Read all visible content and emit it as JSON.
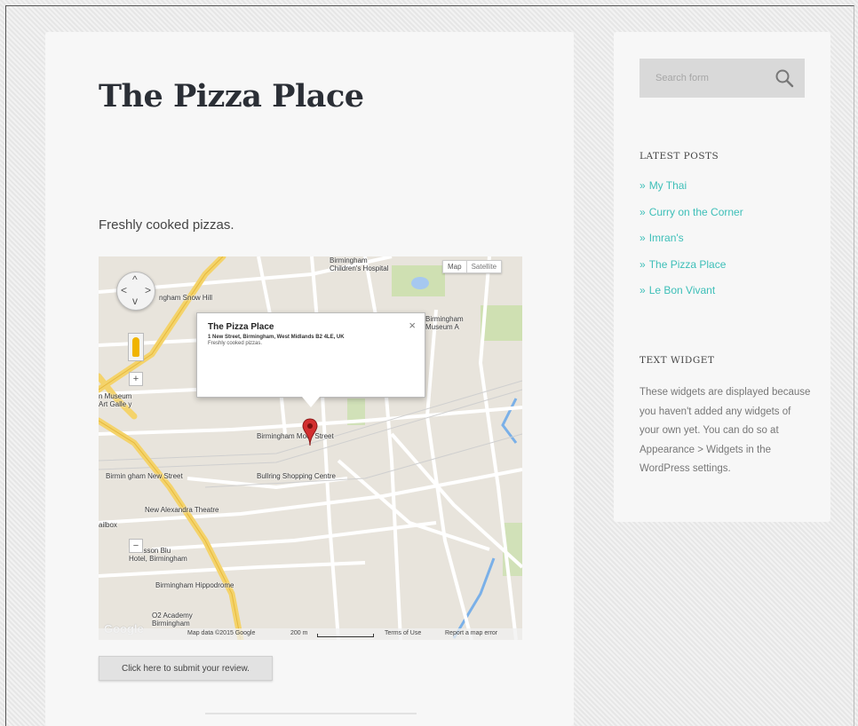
{
  "post": {
    "title": "The Pizza Place",
    "excerpt": "Freshly cooked pizzas.",
    "review_button": "Click here to submit your review."
  },
  "map": {
    "type_map": "Map",
    "type_satellite": "Satellite",
    "info_window": {
      "title": "The Pizza Place",
      "address": "1 New Street, Birmingham, West Midlands B2 4LE, UK",
      "description": "Freshly cooked pizzas.",
      "close": "×"
    },
    "labels": {
      "childrens_hospital": "Birmingham\nChildren's Hospital",
      "snow_hill": "ngham Snow Hill",
      "museum_right": "Birmingham\nMuseum A",
      "museum_left": "n Museum\nArt Galle y",
      "moor_street": "Birmingham Moor Street",
      "new_street": "Birmin gham New Street",
      "bullring": "Bullring Shopping Centre",
      "new_alexandra": "New Alexandra Theatre",
      "mailbox": "ailbox",
      "radisson": "Radisson Blu\nHotel, Birmingham",
      "hippodrome": "Birmingham Hippodrome",
      "o2_academy": "O2 Academy\nBirmingham"
    },
    "footer": {
      "google": "Google",
      "map_data": "Map data ©2015 Google",
      "scale": "200 m",
      "terms": "Terms of Use",
      "report": "Report a map error"
    },
    "colors": {
      "background": "#e8e4dc",
      "road_major": "#f4d36b",
      "road_minor": "#ffffff",
      "park": "#c8dfa8",
      "water": "#a6c8f0",
      "marker": "#d32f2f"
    }
  },
  "sidebar": {
    "search_placeholder": "Search form",
    "latest_posts_title": "LATEST POSTS",
    "latest_posts": [
      {
        "label": "My Thai"
      },
      {
        "label": "Curry on the Corner"
      },
      {
        "label": "Imran's"
      },
      {
        "label": "The Pizza Place"
      },
      {
        "label": "Le Bon Vivant"
      }
    ],
    "bullet": "»",
    "text_widget_title": "TEXT WIDGET",
    "text_widget_body": "These widgets are displayed because you haven't added any widgets of your own yet. You can do so at Appearance > Widgets in the WordPress settings.",
    "link_color": "#3dbfb8"
  }
}
